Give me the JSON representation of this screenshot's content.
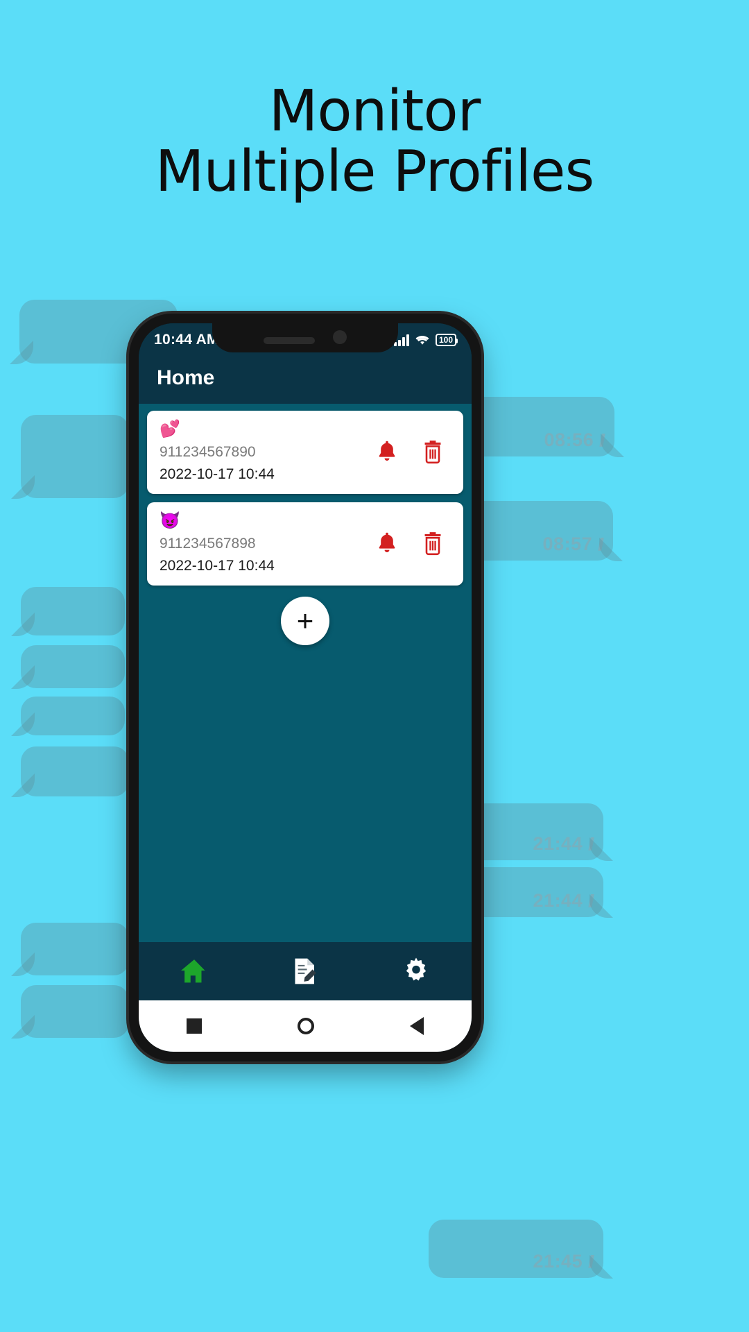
{
  "promo": {
    "heading_line1": "Monitor",
    "heading_line2": "Multiple Profiles",
    "background_color": "#5BDDF8"
  },
  "decor": {
    "bubble_color": "#5A96A5",
    "bubbles": [
      {
        "timestamp": "",
        "ticks": ""
      },
      {
        "timestamp": "08:56",
        "ticks": "//"
      },
      {
        "timestamp": "08:57",
        "ticks": "//"
      },
      {
        "timestamp": "",
        "ticks": ""
      },
      {
        "timestamp": "",
        "ticks": ""
      },
      {
        "timestamp": "",
        "ticks": ""
      },
      {
        "timestamp": "",
        "ticks": ""
      },
      {
        "timestamp": "21:44",
        "ticks": "//"
      },
      {
        "timestamp": "21:44",
        "ticks": "//"
      },
      {
        "timestamp": "",
        "ticks": ""
      },
      {
        "timestamp": "21:45",
        "ticks": "//"
      }
    ]
  },
  "phone": {
    "statusbar": {
      "time": "10:44 AM",
      "signal_icon": "signal-bars-icon",
      "wifi_icon": "wifi-icon",
      "battery_label": "100"
    },
    "appbar": {
      "title": "Home"
    },
    "cards": [
      {
        "emoji": "💕",
        "emoji_name": "two-hearts-emoji",
        "number": "911234567890",
        "datetime": "2022-10-17 10:44",
        "bell_icon": "bell-icon",
        "delete_icon": "trash-icon"
      },
      {
        "emoji": "😈",
        "emoji_name": "smiling-imp-emoji",
        "number": "911234567898",
        "datetime": "2022-10-17 10:44",
        "bell_icon": "bell-icon",
        "delete_icon": "trash-icon"
      }
    ],
    "fab": {
      "label": "+",
      "icon": "plus-icon"
    },
    "bottomnav": [
      {
        "icon": "home-icon",
        "active": true
      },
      {
        "icon": "notes-edit-icon",
        "active": false
      },
      {
        "icon": "gear-icon",
        "active": false
      }
    ],
    "sysnav": [
      {
        "icon": "recents-square-icon"
      },
      {
        "icon": "home-circle-icon"
      },
      {
        "icon": "back-triangle-icon"
      }
    ],
    "colors": {
      "appbar": "#0B3446",
      "body": "#075B6E",
      "card": "#FFFFFF",
      "bell": "#D32020",
      "trash": "#D32020",
      "home_active": "#1DA62B"
    }
  }
}
